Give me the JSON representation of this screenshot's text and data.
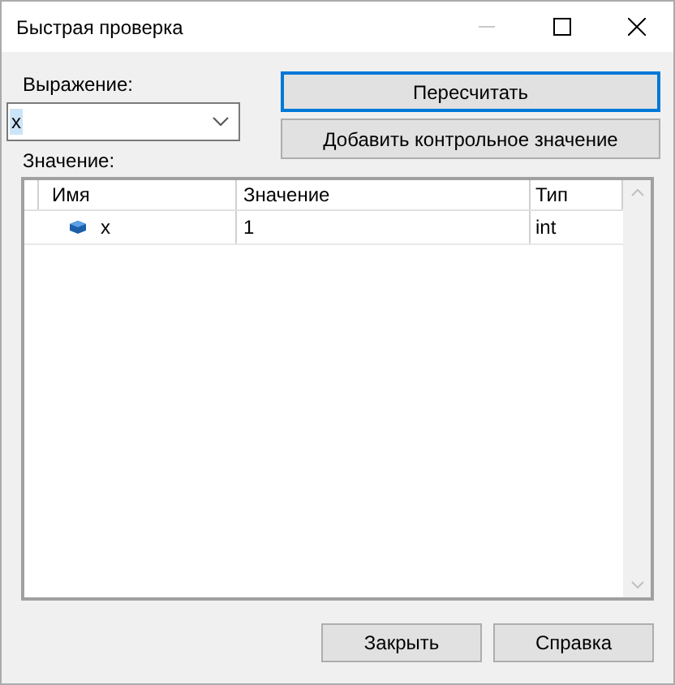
{
  "window": {
    "title": "Быстрая проверка"
  },
  "expression": {
    "label": "Выражение:",
    "value": "x"
  },
  "buttons_top": [
    {
      "label": "Пересчитать",
      "focused": true
    },
    {
      "label": "Добавить контрольное значение",
      "focused": false
    }
  ],
  "value_label": "Значение:",
  "table": {
    "columns": [
      "Имя",
      "Значение",
      "Тип"
    ],
    "rows": [
      {
        "name": "x",
        "value": "1",
        "type": "int",
        "selected": false
      }
    ]
  },
  "buttons_bottom": [
    "Закрыть",
    "Справка"
  ]
}
